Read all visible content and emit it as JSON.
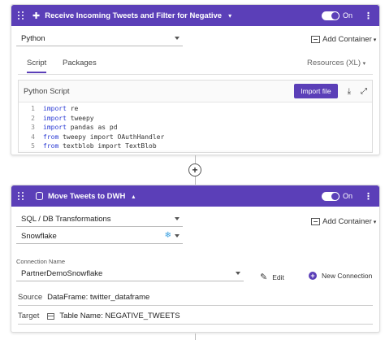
{
  "step1": {
    "title": "Receive Incoming Tweets and Filter for Negative",
    "toggle_label": "On",
    "language": "Python",
    "add_container": "Add Container",
    "tabs": [
      "Script",
      "Packages"
    ],
    "resources": "Resources (XL)",
    "script_label": "Python Script",
    "import_button": "Import file",
    "code": [
      {
        "n": "1",
        "kw": "import",
        "rest": " re"
      },
      {
        "n": "2",
        "kw": "import",
        "rest": " tweepy"
      },
      {
        "n": "3",
        "kw": "import",
        "rest": " pandas as pd"
      },
      {
        "n": "4",
        "kw": "from",
        "rest": " tweepy import OAuthHandler"
      },
      {
        "n": "5",
        "kw": "from",
        "rest": " textblob import TextBlob"
      }
    ]
  },
  "step2": {
    "title": "Move Tweets to DWH",
    "toggle_label": "On",
    "transform": "SQL / DB Transformations",
    "add_container": "Add Container",
    "warehouse": "Snowflake",
    "connection_label": "Connection Name",
    "connection": "PartnerDemoSnowflake",
    "edit_label": "Edit",
    "new_connection_label": "New Connection",
    "source_label": "Source",
    "source_value": "DataFrame: twitter_dataframe",
    "target_label": "Target",
    "target_value": "Table Name: NEGATIVE_TWEETS"
  },
  "colors": {
    "accent": "#5b3fb8"
  }
}
